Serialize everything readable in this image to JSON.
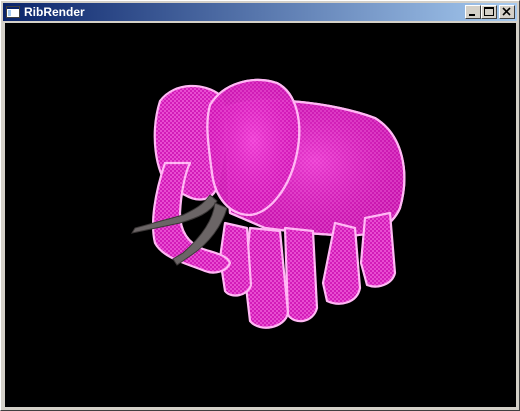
{
  "window": {
    "title": "RibRender",
    "icon": "app-window-icon",
    "controls": {
      "minimize_icon": "minimize-icon",
      "maximize_icon": "maximize-icon",
      "close_icon": "close-icon"
    }
  },
  "viewport": {
    "background": "#000000",
    "model_color": "#ff33dd",
    "tusk_color": "#6b6566"
  }
}
